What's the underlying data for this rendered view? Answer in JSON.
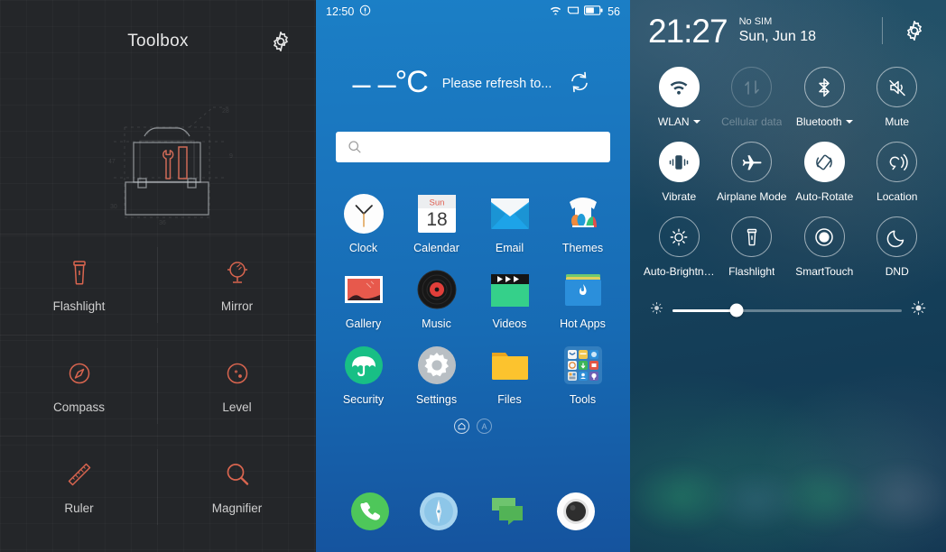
{
  "toolbox": {
    "title": "Toolbox",
    "gear_icon": "gear-icon",
    "hero_icon": "toolbox-blueprint-illustration",
    "items": [
      {
        "label": "Flashlight",
        "icon": "flashlight-icon"
      },
      {
        "label": "Mirror",
        "icon": "mirror-icon"
      },
      {
        "label": "Compass",
        "icon": "compass-icon"
      },
      {
        "label": "Level",
        "icon": "level-icon"
      },
      {
        "label": "Ruler",
        "icon": "ruler-icon"
      },
      {
        "label": "Magnifier",
        "icon": "magnifier-icon"
      }
    ],
    "colors": {
      "background": "#242629",
      "accent": "#d9654f",
      "label": "#cfcfcf"
    }
  },
  "home": {
    "status_bar": {
      "time": "12:50",
      "left_icon": "alert-circle-icon",
      "wifi_icon": "wifi-icon",
      "sim_icon": "sim-card-icon",
      "battery_icon": "battery-icon",
      "battery_percent": "56"
    },
    "weather": {
      "temperature": "– –",
      "degree_unit": "°C",
      "message": "Please refresh to...",
      "refresh_icon": "refresh-icon"
    },
    "search": {
      "placeholder": "",
      "value": "",
      "icon": "search-icon"
    },
    "apps": [
      {
        "label": "Clock",
        "icon": "clock-icon"
      },
      {
        "label": "Calendar",
        "icon": "calendar-icon",
        "day_name": "Sun",
        "day_number": "18"
      },
      {
        "label": "Email",
        "icon": "email-icon"
      },
      {
        "label": "Themes",
        "icon": "themes-icon"
      },
      {
        "label": "Gallery",
        "icon": "gallery-icon"
      },
      {
        "label": "Music",
        "icon": "music-icon"
      },
      {
        "label": "Videos",
        "icon": "videos-icon"
      },
      {
        "label": "Hot Apps",
        "icon": "hot-apps-icon"
      },
      {
        "label": "Security",
        "icon": "security-umbrella-icon"
      },
      {
        "label": "Settings",
        "icon": "settings-gear-icon"
      },
      {
        "label": "Files",
        "icon": "files-folder-icon"
      },
      {
        "label": "Tools",
        "icon": "tools-folder-icon"
      }
    ],
    "pager": [
      {
        "label": "⌂",
        "name": "page-indicator-home",
        "active": true
      },
      {
        "label": "A",
        "name": "page-indicator-a",
        "active": false
      }
    ],
    "dock": [
      {
        "label": "Phone",
        "icon": "phone-icon"
      },
      {
        "label": "Browser",
        "icon": "browser-compass-icon"
      },
      {
        "label": "Messages",
        "icon": "messages-icon"
      },
      {
        "label": "Camera",
        "icon": "camera-icon"
      }
    ],
    "colors": {
      "bg_top": "#1b7fc6",
      "bg_bottom": "#15539e"
    }
  },
  "quick_settings": {
    "clock": "21:27",
    "sim_status": "No SIM",
    "date": "Sun, Jun 18",
    "gear_icon": "gear-icon",
    "tiles": [
      {
        "label": "WLAN",
        "icon": "wifi-icon",
        "state": "on",
        "caret": true
      },
      {
        "label": "Cellular data",
        "icon": "data-arrows-icon",
        "state": "disabled",
        "caret": false
      },
      {
        "label": "Bluetooth",
        "icon": "bluetooth-icon",
        "state": "outline",
        "caret": true
      },
      {
        "label": "Mute",
        "icon": "mute-icon",
        "state": "outline",
        "caret": false
      },
      {
        "label": "Vibrate",
        "icon": "vibrate-icon",
        "state": "on",
        "caret": false
      },
      {
        "label": "Airplane Mode",
        "icon": "airplane-icon",
        "state": "outline",
        "caret": false
      },
      {
        "label": "Auto-Rotate",
        "icon": "auto-rotate-icon",
        "state": "on",
        "caret": false
      },
      {
        "label": "Location",
        "icon": "location-icon",
        "state": "outline",
        "caret": false
      },
      {
        "label": "Auto-Brightn…",
        "icon": "brightness-icon",
        "state": "outline",
        "caret": false
      },
      {
        "label": "Flashlight",
        "icon": "flashlight-icon",
        "state": "outline",
        "caret": false
      },
      {
        "label": "SmartTouch",
        "icon": "smarttouch-icon",
        "state": "outline",
        "caret": false
      },
      {
        "label": "DND",
        "icon": "moon-icon",
        "state": "outline",
        "caret": false
      }
    ],
    "brightness": {
      "value": 28,
      "min_icon": "brightness-low-icon",
      "max_icon": "brightness-high-icon"
    },
    "colors": {
      "bg": "#17415c",
      "accent": "#ffffff"
    }
  }
}
